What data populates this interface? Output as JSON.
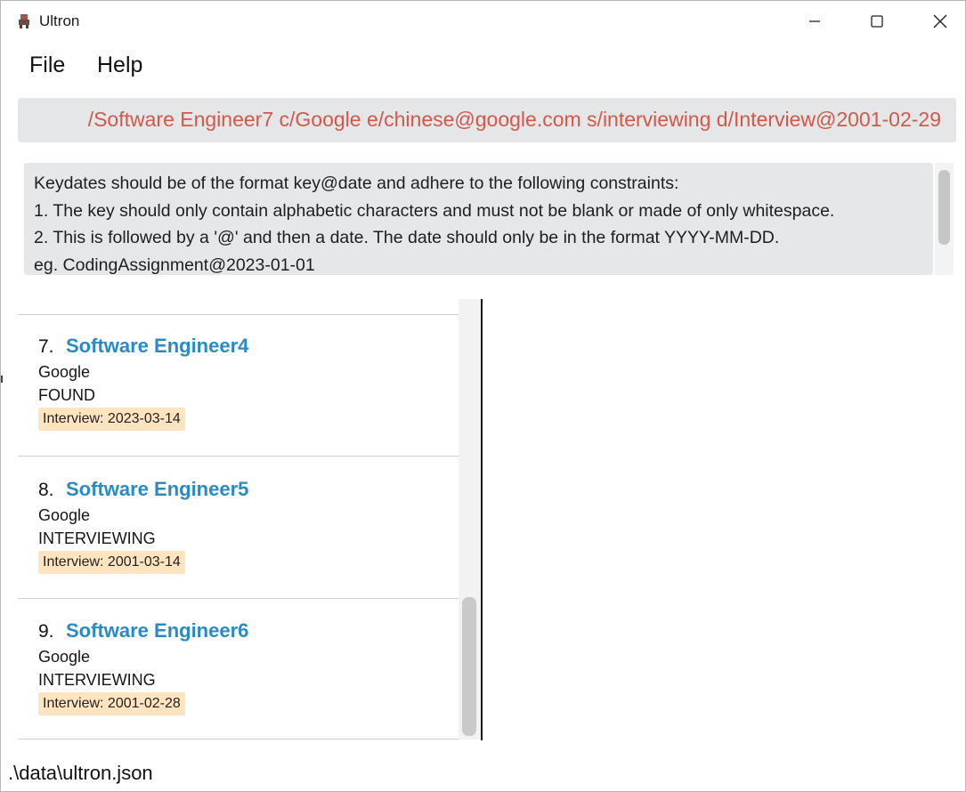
{
  "window": {
    "title": "Ultron"
  },
  "menu": {
    "items": [
      "File",
      "Help"
    ]
  },
  "command_box": {
    "value": "/Software Engineer7 c/Google e/chinese@google.com s/interviewing d/Interview@2001-02-29"
  },
  "result_box": {
    "lines": [
      "Keydates should be of the format key@date and adhere to the following constraints:",
      "1. The key should only contain alphabetic characters and must not be blank or made of only whitespace.",
      "2. This is followed by a '@' and then a date. The date should only be in the format YYYY-MM-DD.",
      "eg. CodingAssignment@2023-01-01"
    ]
  },
  "opening_list": [
    {
      "index": "7.",
      "title": "Software Engineer4",
      "company": "Google",
      "status": "FOUND",
      "keydate": "Interview: 2023-03-14"
    },
    {
      "index": "8.",
      "title": "Software Engineer5",
      "company": "Google",
      "status": "INTERVIEWING",
      "keydate": "Interview: 2001-03-14"
    },
    {
      "index": "9.",
      "title": "Software Engineer6",
      "company": "Google",
      "status": "INTERVIEWING",
      "keydate": "Interview: 2001-02-28"
    }
  ],
  "status_bar": {
    "path": ".\\data\\ultron.json"
  },
  "colors": {
    "title_blue": "#2a8bc3",
    "command_text": "#d2584a",
    "badge_bg": "#ffe4bf"
  }
}
